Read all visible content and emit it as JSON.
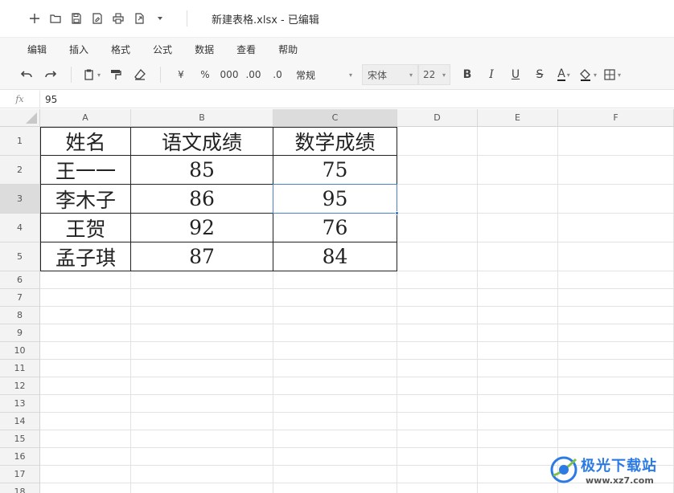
{
  "title_bar": {
    "document_title": "新建表格.xlsx - 已编辑",
    "quick_actions": [
      "new-icon",
      "open-folder-icon",
      "save-icon",
      "save-as-icon",
      "print-icon",
      "export-icon",
      "more-caret-icon"
    ]
  },
  "menu": {
    "items": [
      "编辑",
      "插入",
      "格式",
      "公式",
      "数据",
      "查看",
      "帮助"
    ]
  },
  "toolbar": {
    "currency": "¥",
    "percent": "%",
    "thousands": "000",
    "inc_decimal": ".00",
    "dec_decimal": ".0",
    "number_format": "常规",
    "font_name": "宋体",
    "font_size": "22",
    "bold": "B",
    "italic": "I",
    "underline": "U",
    "strike": "S",
    "font_color": "A"
  },
  "formula_bar": {
    "fx_label": "fx",
    "value": "95"
  },
  "sheet": {
    "columns": [
      "A",
      "B",
      "C",
      "D",
      "E",
      "F"
    ],
    "rows": [
      "1",
      "2",
      "3",
      "4",
      "5",
      "6",
      "7",
      "8",
      "9",
      "10",
      "11",
      "12",
      "13",
      "14",
      "15",
      "16",
      "17",
      "18"
    ],
    "selected_cell": "C3",
    "table": [
      [
        "姓名",
        "语文成绩",
        "数学成绩"
      ],
      [
        "王一一",
        "85",
        "75"
      ],
      [
        "李木子",
        "86",
        "95"
      ],
      [
        "王贺",
        "92",
        "76"
      ],
      [
        "孟子琪",
        "87",
        "84"
      ]
    ]
  },
  "watermark": {
    "text": "极光下载站",
    "url": "www.xz7.com"
  },
  "colors": {
    "selection": "#4a7fcf",
    "header_bg": "#f3f3f3",
    "header_selected_bg": "#dcdcdc",
    "watermark_blue": "#2c7be5"
  }
}
